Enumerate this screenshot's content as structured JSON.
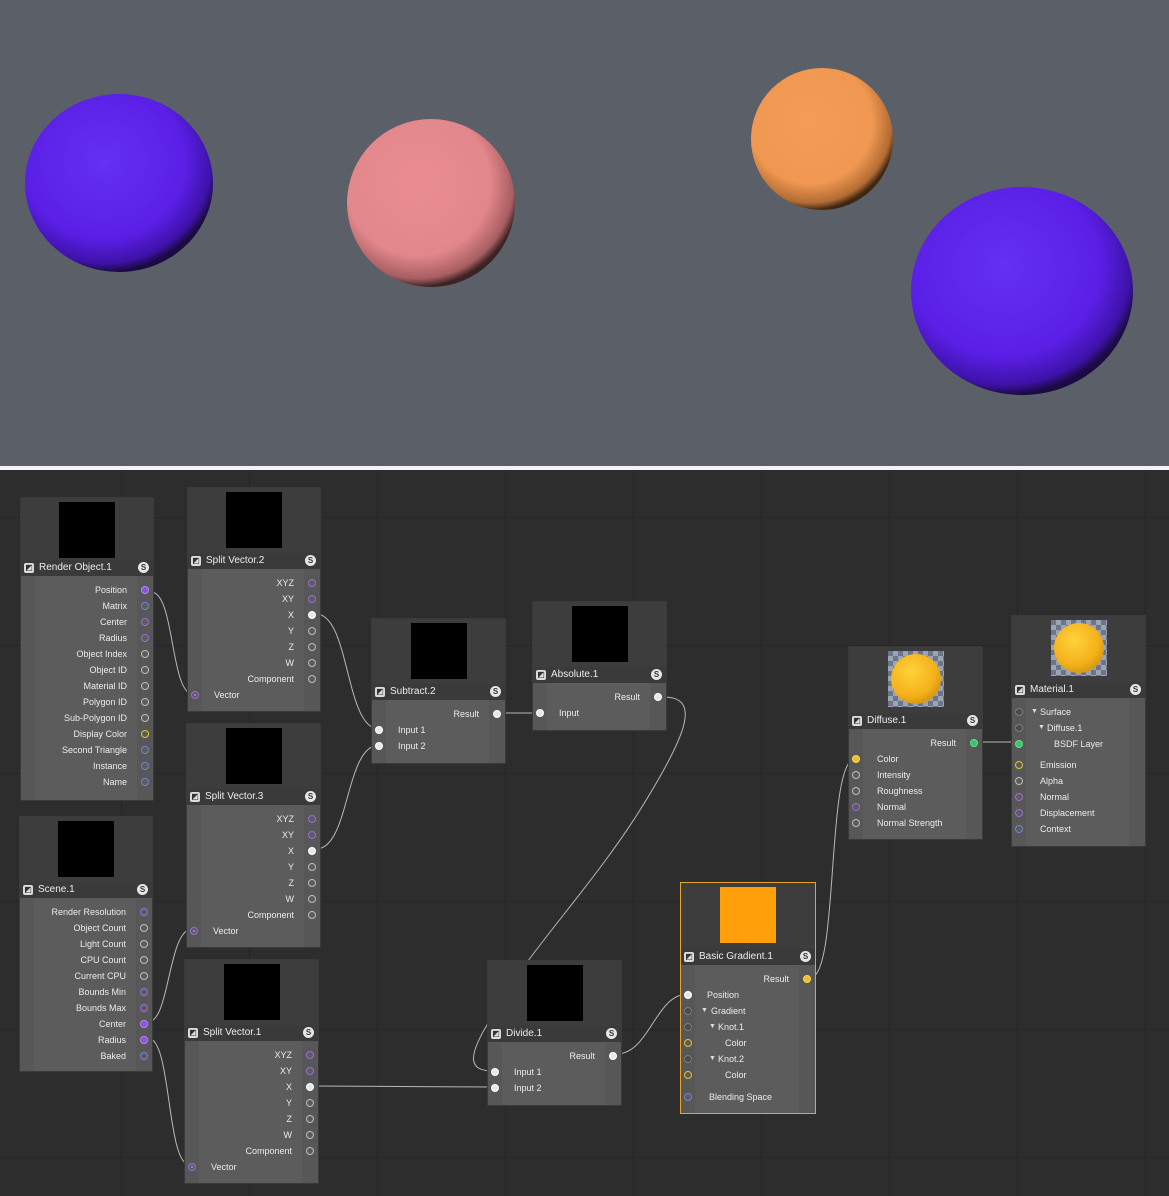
{
  "viewport": {
    "spheres": [
      {
        "name": "sphere-blue-left",
        "color": "#5b22e8"
      },
      {
        "name": "sphere-pink",
        "color": "#e48a8e"
      },
      {
        "name": "sphere-orange",
        "color": "#f39b56"
      },
      {
        "name": "sphere-blue-right",
        "color": "#5b22e8"
      }
    ]
  },
  "nodes": {
    "render_object": {
      "title": "Render Object.1",
      "outputs": [
        "Position",
        "Matrix",
        "Center",
        "Radius",
        "Object Index",
        "Object ID",
        "Material ID",
        "Polygon ID",
        "Sub-Polygon ID",
        "Display Color",
        "Second Triangle",
        "Instance",
        "Name"
      ]
    },
    "scene": {
      "title": "Scene.1",
      "outputs": [
        "Render Resolution",
        "Object Count",
        "Light Count",
        "CPU Count",
        "Current CPU",
        "Bounds Min",
        "Bounds Max",
        "Center",
        "Radius",
        "Baked"
      ]
    },
    "split_vector_2": {
      "title": "Split Vector.2",
      "outputs": [
        "XYZ",
        "XY",
        "X",
        "Y",
        "Z",
        "W",
        "Component"
      ],
      "input": "Vector"
    },
    "split_vector_3": {
      "title": "Split Vector.3",
      "outputs": [
        "XYZ",
        "XY",
        "X",
        "Y",
        "Z",
        "W",
        "Component"
      ],
      "input": "Vector"
    },
    "split_vector_1": {
      "title": "Split Vector.1",
      "outputs": [
        "XYZ",
        "XY",
        "X",
        "Y",
        "Z",
        "W",
        "Component"
      ],
      "input": "Vector"
    },
    "subtract": {
      "title": "Subtract.2",
      "output": "Result",
      "inputs": [
        "Input 1",
        "Input 2"
      ]
    },
    "absolute": {
      "title": "Absolute.1",
      "output": "Result",
      "inputs": [
        "Input"
      ]
    },
    "divide": {
      "title": "Divide.1",
      "output": "Result",
      "inputs": [
        "Input 1",
        "Input 2"
      ]
    },
    "basic_gradient": {
      "title": "Basic Gradient.1",
      "output": "Result",
      "inputs": [
        "Position",
        "Gradient",
        "Knot.1",
        "Color",
        "Knot.2",
        "Color",
        "Blending Space"
      ],
      "swatch": "#ff9f0a"
    },
    "diffuse": {
      "title": "Diffuse.1",
      "output": "Result",
      "inputs": [
        "Color",
        "Intensity",
        "Roughness",
        "Normal",
        "Normal Strength"
      ]
    },
    "material": {
      "title": "Material.1",
      "inputs": [
        "Surface",
        "Diffuse.1",
        "BSDF Layer",
        "Emission",
        "Alpha",
        "Normal",
        "Displacement",
        "Context"
      ]
    }
  },
  "icons": {
    "node": "node-type-icon",
    "solo": "s-badge-icon"
  }
}
